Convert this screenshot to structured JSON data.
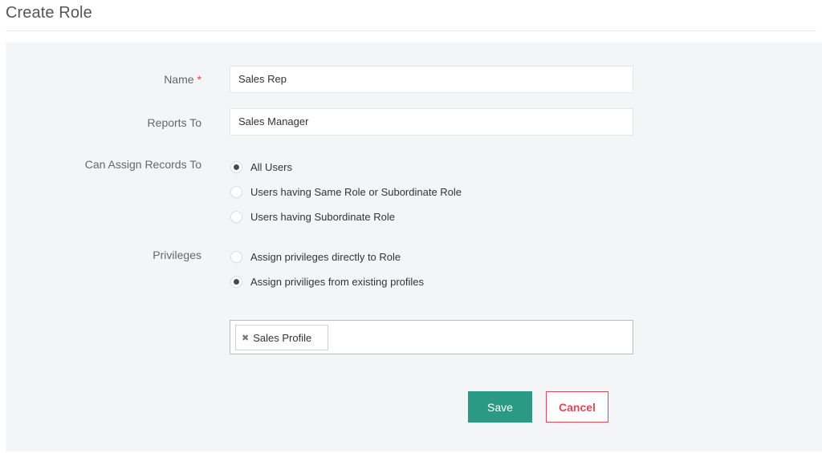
{
  "header": {
    "title": "Create Role"
  },
  "form": {
    "name": {
      "label": "Name",
      "required_marker": "*",
      "value": "Sales Rep"
    },
    "reports_to": {
      "label": "Reports To",
      "value": "Sales Manager"
    },
    "assign_records": {
      "label": "Can Assign Records To",
      "options": [
        {
          "label": "All Users",
          "checked": true
        },
        {
          "label": "Users having Same Role or Subordinate Role",
          "checked": false
        },
        {
          "label": "Users having Subordinate Role",
          "checked": false
        }
      ]
    },
    "privileges": {
      "label": "Privileges",
      "options": [
        {
          "label": "Assign privileges directly to Role",
          "checked": false
        },
        {
          "label": "Assign priviliges from existing profiles",
          "checked": true
        }
      ]
    },
    "profiles": {
      "selected": [
        {
          "label": "Sales Profile",
          "remove_symbol": "✖"
        }
      ]
    }
  },
  "actions": {
    "save_label": "Save",
    "cancel_label": "Cancel"
  },
  "colors": {
    "accent": "#2b9a84",
    "danger": "#e0485a",
    "required": "#e24c4b",
    "panel_bg": "#f4f5f7"
  }
}
